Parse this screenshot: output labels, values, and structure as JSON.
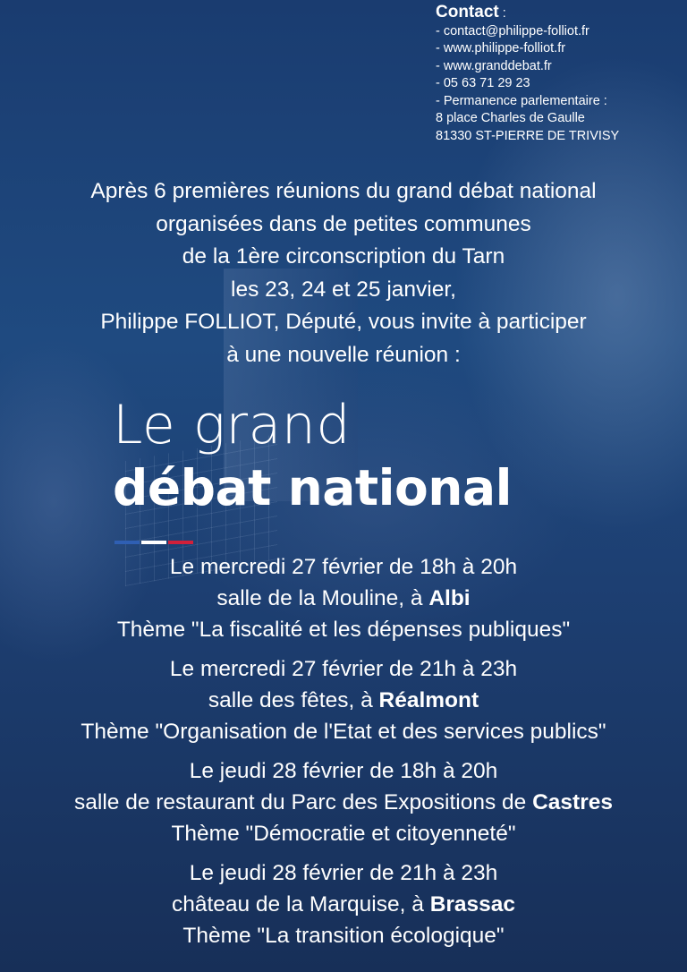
{
  "contact": {
    "heading": "Contact",
    "heading_suffix": " :",
    "lines": [
      "- contact@philippe-folliot.fr",
      "- www.philippe-folliot.fr",
      "- www.granddebat.fr",
      "- 05 63 71 29 23",
      "- Permanence parlementaire :",
      "8 place Charles de Gaulle",
      "81330 ST-PIERRE DE TRIVISY"
    ]
  },
  "intro": {
    "lines": [
      "Après 6 premières réunions du grand débat national",
      "organisées dans de petites communes",
      "de la 1ère circonscription du Tarn",
      "les 23, 24 et 25 janvier,",
      "Philippe FOLLIOT, Député, vous invite à participer",
      "à une nouvelle réunion :"
    ]
  },
  "logo": {
    "line1": "Le grand",
    "line2": "débat national",
    "colors": [
      "#2f5fb3",
      "#ffffff",
      "#d1203a"
    ]
  },
  "events": [
    {
      "date": "Le mercredi 27 février de 18h à 20h",
      "venue_prefix": "salle de la Mouline, à ",
      "city": "Albi",
      "theme": "Thème \"La fiscalité et les dépenses publiques\""
    },
    {
      "date": "Le mercredi 27 février de 21h à 23h",
      "venue_prefix": "salle des fêtes, à ",
      "city": "Réalmont",
      "theme": "Thème \"Organisation de l'Etat et des services publics\""
    },
    {
      "date": "Le jeudi 28 février de 18h à 20h",
      "venue_prefix": "salle de restaurant du Parc des Expositions de ",
      "city": "Castres",
      "theme": "Thème \"Démocratie et citoyenneté\""
    },
    {
      "date": "Le jeudi 28 février de 21h à 23h",
      "venue_prefix": "château de la Marquise, à ",
      "city": "Brassac",
      "theme": "Thème \"La transition écologique\""
    }
  ]
}
